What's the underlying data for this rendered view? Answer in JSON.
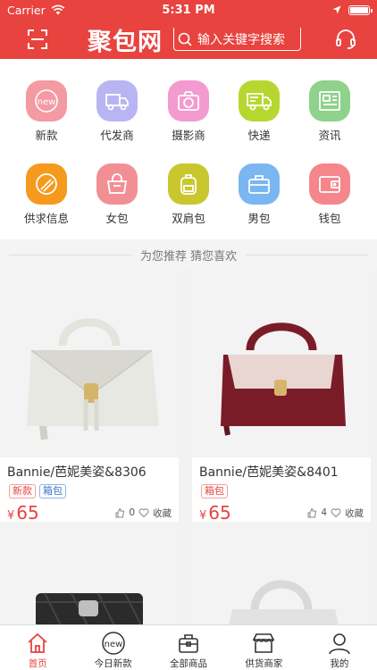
{
  "status": {
    "carrier": "Carrier",
    "time": "5:31 PM"
  },
  "nav": {
    "logo": "聚包网",
    "search_placeholder": "输入关键字搜索"
  },
  "categories": [
    {
      "label": "新款",
      "icon": "new-icon",
      "color": "#f39aa3"
    },
    {
      "label": "代发商",
      "icon": "truck-icon",
      "color": "#b9b5f2"
    },
    {
      "label": "摄影商",
      "icon": "camera-icon",
      "color": "#f39ad0"
    },
    {
      "label": "快递",
      "icon": "delivery-truck-icon",
      "color": "#b8d630"
    },
    {
      "label": "资讯",
      "icon": "newspaper-icon",
      "color": "#8ed28b"
    },
    {
      "label": "供求信息",
      "icon": "pencil-icon",
      "color": "#f59a1d"
    },
    {
      "label": "女包",
      "icon": "handbag-icon",
      "color": "#f28f95"
    },
    {
      "label": "双肩包",
      "icon": "backpack-icon",
      "color": "#c9c72e"
    },
    {
      "label": "男包",
      "icon": "briefcase-icon",
      "color": "#79b6f2"
    },
    {
      "label": "钱包",
      "icon": "wallet-icon",
      "color": "#f5868c"
    }
  ],
  "section_title": "为您推荐 猜您喜欢",
  "products": [
    {
      "title": "Bannie/芭妮美姿&8306",
      "tags": [
        {
          "text": "新款",
          "style": "red"
        },
        {
          "text": "箱包",
          "style": "blue"
        }
      ],
      "currency": "¥",
      "price": "65",
      "likes": "0",
      "fav": "收藏",
      "bag_color": "#dcdcd6"
    },
    {
      "title": "Bannie/芭妮美姿&8401",
      "tags": [
        {
          "text": "箱包",
          "style": "red"
        }
      ],
      "currency": "¥",
      "price": "65",
      "likes": "4",
      "fav": "收藏",
      "bag_color": "#7a1c27"
    },
    {
      "title": "",
      "tags": [],
      "currency": "",
      "price": "",
      "likes": "",
      "fav": "",
      "bag_color": "#2b2b2b"
    },
    {
      "title": "",
      "tags": [],
      "currency": "",
      "price": "",
      "likes": "",
      "fav": "",
      "bag_color": "#d9d9d9"
    }
  ],
  "tabs": [
    {
      "label": "首页",
      "icon": "home-icon",
      "active": true
    },
    {
      "label": "今日新款",
      "icon": "new-badge-icon",
      "active": false
    },
    {
      "label": "全部商品",
      "icon": "box-icon",
      "active": false
    },
    {
      "label": "供货商家",
      "icon": "store-icon",
      "active": false
    },
    {
      "label": "我的",
      "icon": "user-icon",
      "active": false
    }
  ],
  "colors": {
    "brand": "#e8433f",
    "tag_blue": "#3a74c7"
  }
}
